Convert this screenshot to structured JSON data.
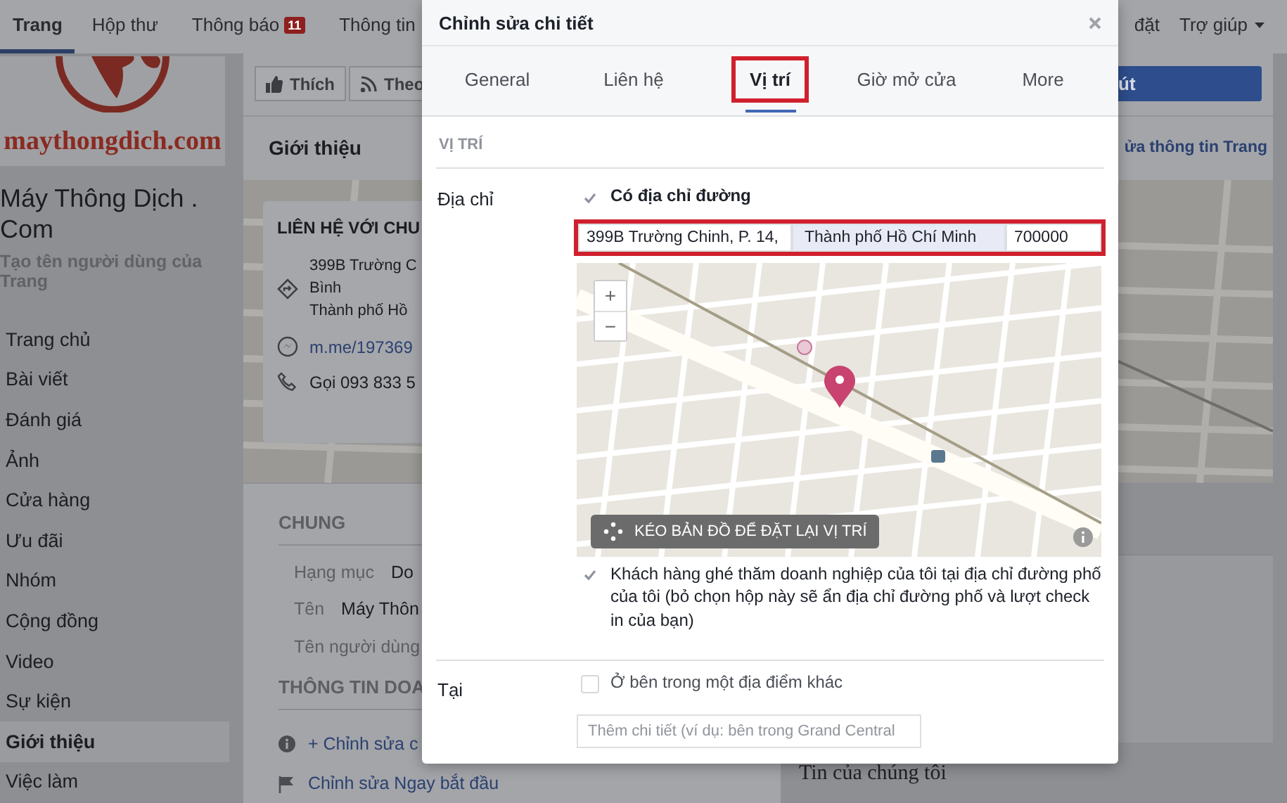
{
  "top_nav": {
    "items": [
      {
        "label": "Trang",
        "selected": true
      },
      {
        "label": "Hộp thư",
        "selected": false
      },
      {
        "label": "Thông báo",
        "selected": false,
        "badge": "11"
      },
      {
        "label": "Thông tin",
        "selected": false
      }
    ],
    "right_items": [
      {
        "label": "đặt",
        "kind": "link"
      },
      {
        "label": "Trợ giúp",
        "kind": "dropdown"
      }
    ]
  },
  "sidebar": {
    "logo_text": "maythongdich.com",
    "page_name": "Máy Thông Dịch . Com",
    "username_link": "Tạo tên người dùng của Trang",
    "items": [
      {
        "label": "Trang chủ",
        "selected": false
      },
      {
        "label": "Bài viết",
        "selected": false
      },
      {
        "label": "Đánh giá",
        "selected": false
      },
      {
        "label": "Ảnh",
        "selected": false
      },
      {
        "label": "Cửa hàng",
        "selected": false
      },
      {
        "label": "Ưu đãi",
        "selected": false
      },
      {
        "label": "Nhóm",
        "selected": false
      },
      {
        "label": "Cộng đồng",
        "selected": false
      },
      {
        "label": "Video",
        "selected": false
      },
      {
        "label": "Sự kiện",
        "selected": false
      },
      {
        "label": "Giới thiệu",
        "selected": true
      },
      {
        "label": "Việc làm",
        "selected": false
      }
    ]
  },
  "page_actions": {
    "buttons": [
      {
        "label": "Thích",
        "kind": "like"
      },
      {
        "label": "Theo",
        "kind": "follow"
      }
    ],
    "primary_button": "út"
  },
  "about_header": {
    "title": "Giới thiệu",
    "edit_link": "ửa thông tin Trang"
  },
  "contact_card": {
    "title": "LIÊN HỆ VỚI CHU",
    "address_lines": [
      "399B Trường C",
      "Bình",
      "Thành phố Hồ"
    ],
    "messenger": "m.me/197369",
    "phone": "Gọi 093 833 5"
  },
  "general": {
    "title": "CHUNG",
    "rows": [
      {
        "label": "Hạng mục",
        "value": "Do"
      },
      {
        "label": "Tên",
        "value": "Máy Thôn"
      },
      {
        "label": "Tên người dùng"
      }
    ]
  },
  "business_info": {
    "title": "THÔNG TIN DOA",
    "links": [
      {
        "kind": "info",
        "label": "+ Chỉnh sửa c"
      },
      {
        "kind": "flag",
        "label": "Chỉnh sửa Ngay bắt đầu"
      }
    ]
  },
  "news_card": {
    "title": "Tin của chúng tôi"
  },
  "dialog": {
    "title": "Chỉnh sửa chi tiết",
    "tabs": [
      {
        "label": "General",
        "selected": false,
        "annotated": false
      },
      {
        "label": "Liên hệ",
        "selected": false,
        "annotated": false
      },
      {
        "label": "Vị trí",
        "selected": true,
        "annotated": true
      },
      {
        "label": "Giờ mở cửa",
        "selected": false,
        "annotated": false
      },
      {
        "label": "More",
        "selected": false,
        "annotated": false
      }
    ],
    "section_title": "VỊ TRÍ",
    "address": {
      "label": "Địa chỉ",
      "has_street": {
        "label": "Có địa chỉ đường",
        "checked": true
      },
      "annotated": true,
      "fields": [
        {
          "value": "399B Trường Chinh, P. 14,",
          "highlighted": false
        },
        {
          "value": "Thành phố Hồ Chí Minh",
          "highlighted": true
        },
        {
          "value": "700000",
          "highlighted": false
        }
      ],
      "map": {
        "zoom_in": "+",
        "zoom_out": "−",
        "drag_button": "KÉO BẢN ĐỒ ĐỂ ĐẶT LẠI VỊ TRÍ"
      },
      "visitors": {
        "label": "Khách hàng ghé thăm doanh nghiệp của tôi tại địa chỉ đường phố của tôi (bỏ chọn hộp này sẽ ẩn địa chỉ đường phố và lượt check in của bạn)",
        "checked": true
      }
    },
    "inside": {
      "label": "Tại",
      "checkbox": {
        "label": "Ở bên trong một địa điểm khác",
        "checked": false
      },
      "placeholder": "Thêm chi tiết (ví dụ: bên trong Grand Central"
    }
  }
}
